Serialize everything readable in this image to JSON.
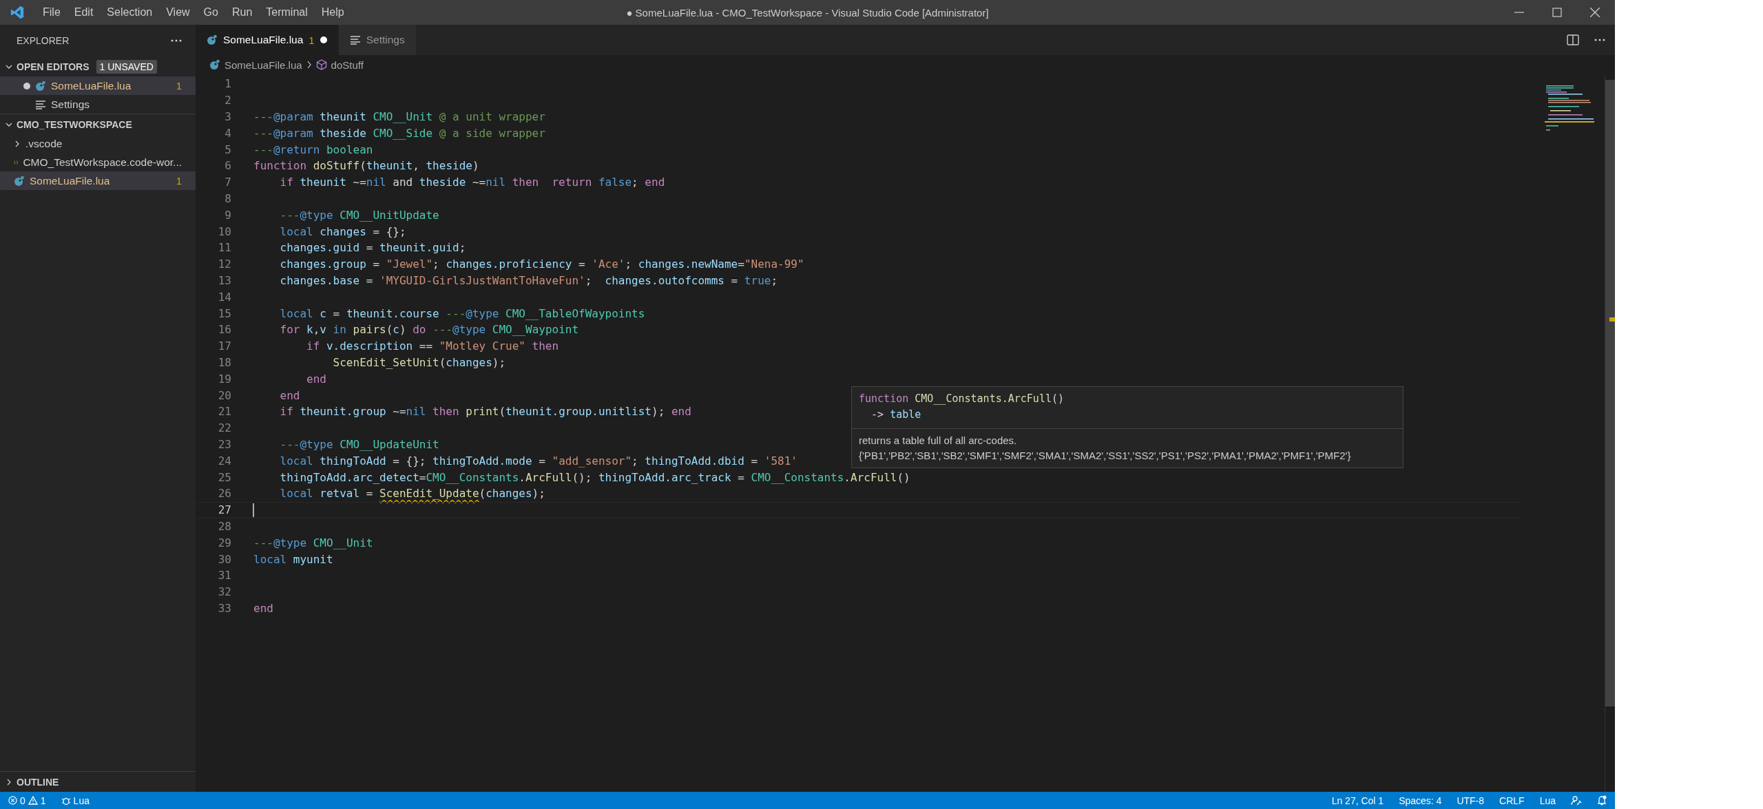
{
  "window": {
    "title": "● SomeLuaFile.lua - CMO_TestWorkspace - Visual Studio Code [Administrator]"
  },
  "menu": [
    "File",
    "Edit",
    "Selection",
    "View",
    "Go",
    "Run",
    "Terminal",
    "Help"
  ],
  "sidebar": {
    "title": "EXPLORER",
    "sections": [
      {
        "title": "OPEN EDITORS",
        "badge": "1 UNSAVED",
        "expanded": true,
        "items": [
          {
            "label": "SomeLuaFile.lua",
            "kind": "lua",
            "count": "1",
            "modified": true,
            "selected": true
          },
          {
            "label": "Settings",
            "kind": "settings",
            "modified": false,
            "selected": false
          }
        ]
      },
      {
        "title": "CMO_TESTWORKSPACE",
        "expanded": true,
        "items": [
          {
            "label": ".vscode",
            "kind": "folder",
            "selected": false
          },
          {
            "label": "CMO_TestWorkspace.code-wor...",
            "kind": "json",
            "selected": false
          },
          {
            "label": "SomeLuaFile.lua",
            "kind": "lua",
            "count": "1",
            "selected": true
          }
        ]
      },
      {
        "title": "OUTLINE",
        "expanded": false
      }
    ]
  },
  "tabs": [
    {
      "label": "SomeLuaFile.lua",
      "kind": "lua",
      "count": "1",
      "modified": true,
      "selected": true
    },
    {
      "label": "Settings",
      "kind": "settings",
      "modified": false,
      "selected": false
    }
  ],
  "breadcrumb": [
    {
      "label": "SomeLuaFile.lua",
      "kind": "lua"
    },
    {
      "label": "doStuff",
      "kind": "symbol"
    }
  ],
  "editor": {
    "lines": [
      {
        "number": "1",
        "current": false
      },
      {
        "number": "2",
        "current": false
      },
      {
        "number": "3",
        "current": false,
        "tokens": [
          {
            "kind": "cm",
            "text": "---"
          },
          {
            "kind": "tag",
            "text": "@param"
          },
          {
            "kind": "var",
            "text": " theunit"
          },
          {
            "kind": "type",
            "text": " CMO__Unit"
          },
          {
            "kind": "cm",
            "text": " @ a unit wrapper"
          }
        ]
      },
      {
        "number": "4",
        "current": false,
        "tokens": [
          {
            "kind": "cm",
            "text": "---"
          },
          {
            "kind": "tag",
            "text": "@param"
          },
          {
            "kind": "var",
            "text": " theside"
          },
          {
            "kind": "type",
            "text": " CMO__Side"
          },
          {
            "kind": "cm",
            "text": " @ a side wrapper"
          }
        ]
      },
      {
        "number": "5",
        "current": false,
        "tokens": [
          {
            "kind": "cm",
            "text": "---"
          },
          {
            "kind": "tag",
            "text": "@return"
          },
          {
            "kind": "type",
            "text": " boolean"
          }
        ]
      },
      {
        "number": "6",
        "current": false,
        "tokens": [
          {
            "kind": "kw",
            "text": "function "
          },
          {
            "kind": "fn",
            "text": "doStuff"
          },
          {
            "kind": "plain",
            "text": "("
          },
          {
            "kind": "var",
            "text": "theunit"
          },
          {
            "kind": "plain",
            "text": ", "
          },
          {
            "kind": "var",
            "text": "theside"
          },
          {
            "kind": "plain",
            "text": ")"
          }
        ]
      },
      {
        "number": "7",
        "current": false,
        "tokens": [
          {
            "kind": "kw",
            "text": "    if "
          },
          {
            "kind": "var",
            "text": "theunit "
          },
          {
            "kind": "plain",
            "text": "~="
          },
          {
            "kind": "const",
            "text": "nil "
          },
          {
            "kind": "plain",
            "text": "and "
          },
          {
            "kind": "var",
            "text": "theside "
          },
          {
            "kind": "plain",
            "text": "~="
          },
          {
            "kind": "const",
            "text": "nil "
          },
          {
            "kind": "kw",
            "text": "then  return "
          },
          {
            "kind": "const",
            "text": "false"
          },
          {
            "kind": "plain",
            "text": "; "
          },
          {
            "kind": "kw",
            "text": "end"
          }
        ]
      },
      {
        "number": "8",
        "current": false
      },
      {
        "number": "9",
        "current": false,
        "tokens": [
          {
            "kind": "cm",
            "text": "    ---"
          },
          {
            "kind": "tag",
            "text": "@type"
          },
          {
            "kind": "type",
            "text": " CMO__UnitUpdate"
          }
        ]
      },
      {
        "number": "10",
        "current": false,
        "tokens": [
          {
            "kind": "const",
            "text": "    local "
          },
          {
            "kind": "var",
            "text": "changes "
          },
          {
            "kind": "plain",
            "text": "= {};"
          }
        ]
      },
      {
        "number": "11",
        "current": false,
        "tokens": [
          {
            "kind": "var",
            "text": "    changes.guid"
          },
          {
            "kind": "plain",
            "text": " = "
          },
          {
            "kind": "var",
            "text": "theunit.guid"
          },
          {
            "kind": "plain",
            "text": ";"
          }
        ]
      },
      {
        "number": "12",
        "current": false,
        "tokens": [
          {
            "kind": "var",
            "text": "    changes.group"
          },
          {
            "kind": "plain",
            "text": " = "
          },
          {
            "kind": "str",
            "text": "\"Jewel\""
          },
          {
            "kind": "plain",
            "text": "; "
          },
          {
            "kind": "var",
            "text": "changes.proficiency"
          },
          {
            "kind": "plain",
            "text": " = "
          },
          {
            "kind": "str",
            "text": "'Ace'"
          },
          {
            "kind": "plain",
            "text": "; "
          },
          {
            "kind": "var",
            "text": "changes.newName"
          },
          {
            "kind": "plain",
            "text": "="
          },
          {
            "kind": "str",
            "text": "\"Nena-99\""
          }
        ]
      },
      {
        "number": "13",
        "current": false,
        "tokens": [
          {
            "kind": "var",
            "text": "    changes.base"
          },
          {
            "kind": "plain",
            "text": " = "
          },
          {
            "kind": "str",
            "text": "'MYGUID-GirlsJustWantToHaveFun'"
          },
          {
            "kind": "plain",
            "text": ";  "
          },
          {
            "kind": "var",
            "text": "changes.outofcomms"
          },
          {
            "kind": "plain",
            "text": " = "
          },
          {
            "kind": "const",
            "text": "true"
          },
          {
            "kind": "plain",
            "text": ";"
          }
        ]
      },
      {
        "number": "14",
        "current": false
      },
      {
        "number": "15",
        "current": false,
        "tokens": [
          {
            "kind": "const",
            "text": "    local "
          },
          {
            "kind": "var",
            "text": "c"
          },
          {
            "kind": "plain",
            "text": " = "
          },
          {
            "kind": "var",
            "text": "theunit.course"
          },
          {
            "kind": "cm",
            "text": " ---"
          },
          {
            "kind": "tag",
            "text": "@type"
          },
          {
            "kind": "type",
            "text": " CMO__TableOfWaypoints"
          }
        ]
      },
      {
        "number": "16",
        "current": false,
        "tokens": [
          {
            "kind": "kw",
            "text": "    for "
          },
          {
            "kind": "var",
            "text": "k"
          },
          {
            "kind": "plain",
            "text": ","
          },
          {
            "kind": "var",
            "text": "v"
          },
          {
            "kind": "const",
            "text": " in "
          },
          {
            "kind": "fn",
            "text": "pairs"
          },
          {
            "kind": "plain",
            "text": "("
          },
          {
            "kind": "var",
            "text": "c"
          },
          {
            "kind": "plain",
            "text": ") "
          },
          {
            "kind": "kw",
            "text": "do"
          },
          {
            "kind": "cm",
            "text": " ---"
          },
          {
            "kind": "tag",
            "text": "@type"
          },
          {
            "kind": "type",
            "text": " CMO__Waypoint"
          }
        ]
      },
      {
        "number": "17",
        "current": false,
        "tokens": [
          {
            "kind": "kw",
            "text": "        if "
          },
          {
            "kind": "var",
            "text": "v.description"
          },
          {
            "kind": "plain",
            "text": " == "
          },
          {
            "kind": "str",
            "text": "\"Motley Crue\""
          },
          {
            "kind": "kw",
            "text": " then"
          }
        ]
      },
      {
        "number": "18",
        "current": false,
        "tokens": [
          {
            "kind": "fn",
            "text": "            ScenEdit_SetUnit"
          },
          {
            "kind": "plain",
            "text": "("
          },
          {
            "kind": "var",
            "text": "changes"
          },
          {
            "kind": "plain",
            "text": ");"
          }
        ]
      },
      {
        "number": "19",
        "current": false,
        "tokens": [
          {
            "kind": "kw",
            "text": "        end"
          }
        ]
      },
      {
        "number": "20",
        "current": false,
        "tokens": [
          {
            "kind": "kw",
            "text": "    end"
          }
        ]
      },
      {
        "number": "21",
        "current": false,
        "tokens": [
          {
            "kind": "kw",
            "text": "    if "
          },
          {
            "kind": "var",
            "text": "theunit.group "
          },
          {
            "kind": "plain",
            "text": "~="
          },
          {
            "kind": "const",
            "text": "nil "
          },
          {
            "kind": "kw",
            "text": "then "
          },
          {
            "kind": "fn",
            "text": "print"
          },
          {
            "kind": "plain",
            "text": "("
          },
          {
            "kind": "var",
            "text": "theunit.group.unitlist"
          },
          {
            "kind": "plain",
            "text": "); "
          },
          {
            "kind": "kw",
            "text": "end"
          }
        ]
      },
      {
        "number": "22",
        "current": false
      },
      {
        "number": "23",
        "current": false,
        "tokens": [
          {
            "kind": "cm",
            "text": "    ---"
          },
          {
            "kind": "tag",
            "text": "@type"
          },
          {
            "kind": "type",
            "text": " CMO__UpdateUnit"
          }
        ]
      },
      {
        "number": "24",
        "current": false,
        "tokens": [
          {
            "kind": "const",
            "text": "    local "
          },
          {
            "kind": "var",
            "text": "thingToAdd"
          },
          {
            "kind": "plain",
            "text": " = {}; "
          },
          {
            "kind": "var",
            "text": "thingToAdd.mode"
          },
          {
            "kind": "plain",
            "text": " = "
          },
          {
            "kind": "str",
            "text": "\"add_sensor\""
          },
          {
            "kind": "plain",
            "text": "; "
          },
          {
            "kind": "var",
            "text": "thingToAdd.dbid"
          },
          {
            "kind": "plain",
            "text": " = "
          },
          {
            "kind": "str",
            "text": "'581'"
          }
        ]
      },
      {
        "number": "25",
        "current": false,
        "tokens": [
          {
            "kind": "var",
            "text": "    thingToAdd.arc_detect"
          },
          {
            "kind": "plain",
            "text": "="
          },
          {
            "kind": "type",
            "text": "CMO__Constants"
          },
          {
            "kind": "plain",
            "text": "."
          },
          {
            "kind": "fn",
            "text": "ArcFull"
          },
          {
            "kind": "plain",
            "text": "(); "
          },
          {
            "kind": "var",
            "text": "thingToAdd.arc_track"
          },
          {
            "kind": "plain",
            "text": " = "
          },
          {
            "kind": "type",
            "text": "CMO__Constants"
          },
          {
            "kind": "plain",
            "text": "."
          },
          {
            "kind": "fn",
            "text": "ArcFull"
          },
          {
            "kind": "plain",
            "text": "()"
          }
        ]
      },
      {
        "number": "26",
        "current": false,
        "tokens": [
          {
            "kind": "const",
            "text": "    local "
          },
          {
            "kind": "var",
            "text": "retval"
          },
          {
            "kind": "plain",
            "text": " = "
          },
          {
            "kind": "warn",
            "text": "ScenEdit_Update"
          },
          {
            "kind": "plain",
            "text": "("
          },
          {
            "kind": "var",
            "text": "changes"
          },
          {
            "kind": "plain",
            "text": ");"
          }
        ]
      },
      {
        "number": "27",
        "current": true
      },
      {
        "number": "28",
        "current": false
      },
      {
        "number": "29",
        "current": false,
        "tokens": [
          {
            "kind": "cm",
            "text": "---"
          },
          {
            "kind": "tag",
            "text": "@type"
          },
          {
            "kind": "type",
            "text": " CMO__Unit"
          }
        ]
      },
      {
        "number": "30",
        "current": false,
        "tokens": [
          {
            "kind": "const",
            "text": "local "
          },
          {
            "kind": "var",
            "text": "myunit"
          }
        ]
      },
      {
        "number": "31",
        "current": false
      },
      {
        "number": "32",
        "current": false
      },
      {
        "number": "33",
        "current": false,
        "tokens": [
          {
            "kind": "kw",
            "text": "end"
          }
        ]
      }
    ]
  },
  "hover": {
    "signature": [
      {
        "kind": "kw",
        "text": "function "
      },
      {
        "kind": "fn",
        "text": "CMO__Constants.ArcFull"
      },
      {
        "kind": "plain",
        "text": "()"
      }
    ],
    "returns": [
      {
        "kind": "plain",
        "text": "  -> "
      },
      {
        "kind": "var",
        "text": "table"
      }
    ],
    "doc": [
      "returns a table full of all arc-codes.",
      "{'PB1','PB2','SB1','SB2','SMF1','SMF2','SMA1','SMA2','SS1','SS2','PS1','PS2','PMA1','PMA2','PMF1','PMF2'}"
    ]
  },
  "status_bar": {
    "errors": "0",
    "warnings": "1",
    "language_left": "Lua",
    "right": [
      "Ln 27, Col 1",
      "Spaces: 4",
      "UTF-8",
      "CRLF",
      "Lua"
    ]
  }
}
